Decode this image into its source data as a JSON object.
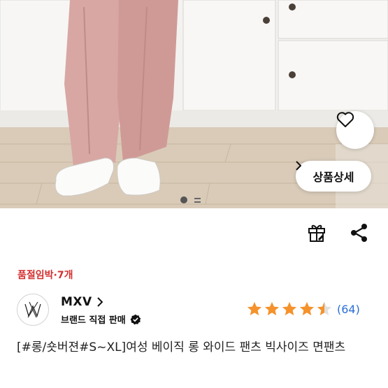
{
  "photo": {
    "alt": "pink wide leg pants with white sneakers",
    "wishlist_icon": "heart-outline-icon",
    "detail_button": {
      "label": "상품상세",
      "icon": "chevron-right-icon"
    },
    "pager": {
      "active": 1
    }
  },
  "actions": {
    "gift_icon": "gift-icon",
    "share_icon": "share-icon"
  },
  "stock_warning": "품절임박·7개",
  "brand": {
    "name": "MXV",
    "subtitle": "브랜드 직접 판매",
    "verified_icon": "verified-check-icon"
  },
  "rating": {
    "score": 4.5,
    "max": 5,
    "review_count": "(64)"
  },
  "product_title": "[#롱/숏버젼#S~XL]여성 베이직 롱 와이드 팬츠 빅사이즈 면팬츠",
  "colors": {
    "star": "#f5922b",
    "warning": "#d32f2f",
    "link": "#2b6fd6"
  }
}
